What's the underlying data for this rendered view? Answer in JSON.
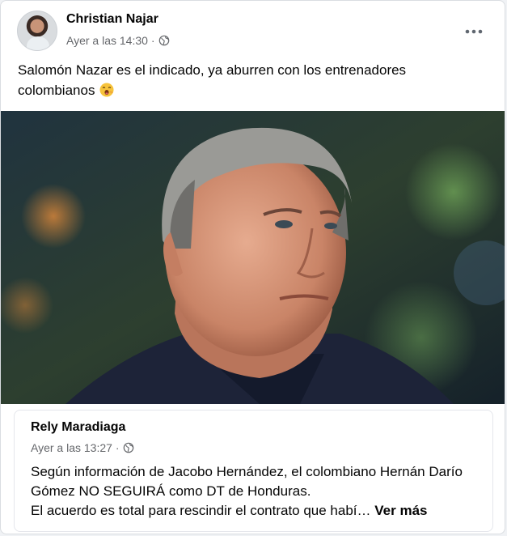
{
  "post": {
    "author": "Christian Najar",
    "timestamp": "Ayer a las 14:30",
    "separator": "·",
    "audience_icon": "globe-icon",
    "more_icon": "•••",
    "text": "Salomón Nazar es el indicado, ya aburren con los entrenadores colombianos",
    "emoji": "yawning-face-emoji"
  },
  "shared_post": {
    "author": "Rely Maradiaga",
    "timestamp": "Ayer a las 13:27",
    "separator": "·",
    "audience_icon": "globe-icon",
    "line1": "Según información de Jacobo Hernández, el colombiano Hernán Darío Gómez NO SEGUIRÁ como DT de Honduras.",
    "line2": "El acuerdo es total para rescindir el contrato que habí…",
    "see_more": "Ver más"
  },
  "colors": {
    "text_primary": "#050505",
    "text_secondary": "#65676b",
    "border": "#dadde1"
  }
}
